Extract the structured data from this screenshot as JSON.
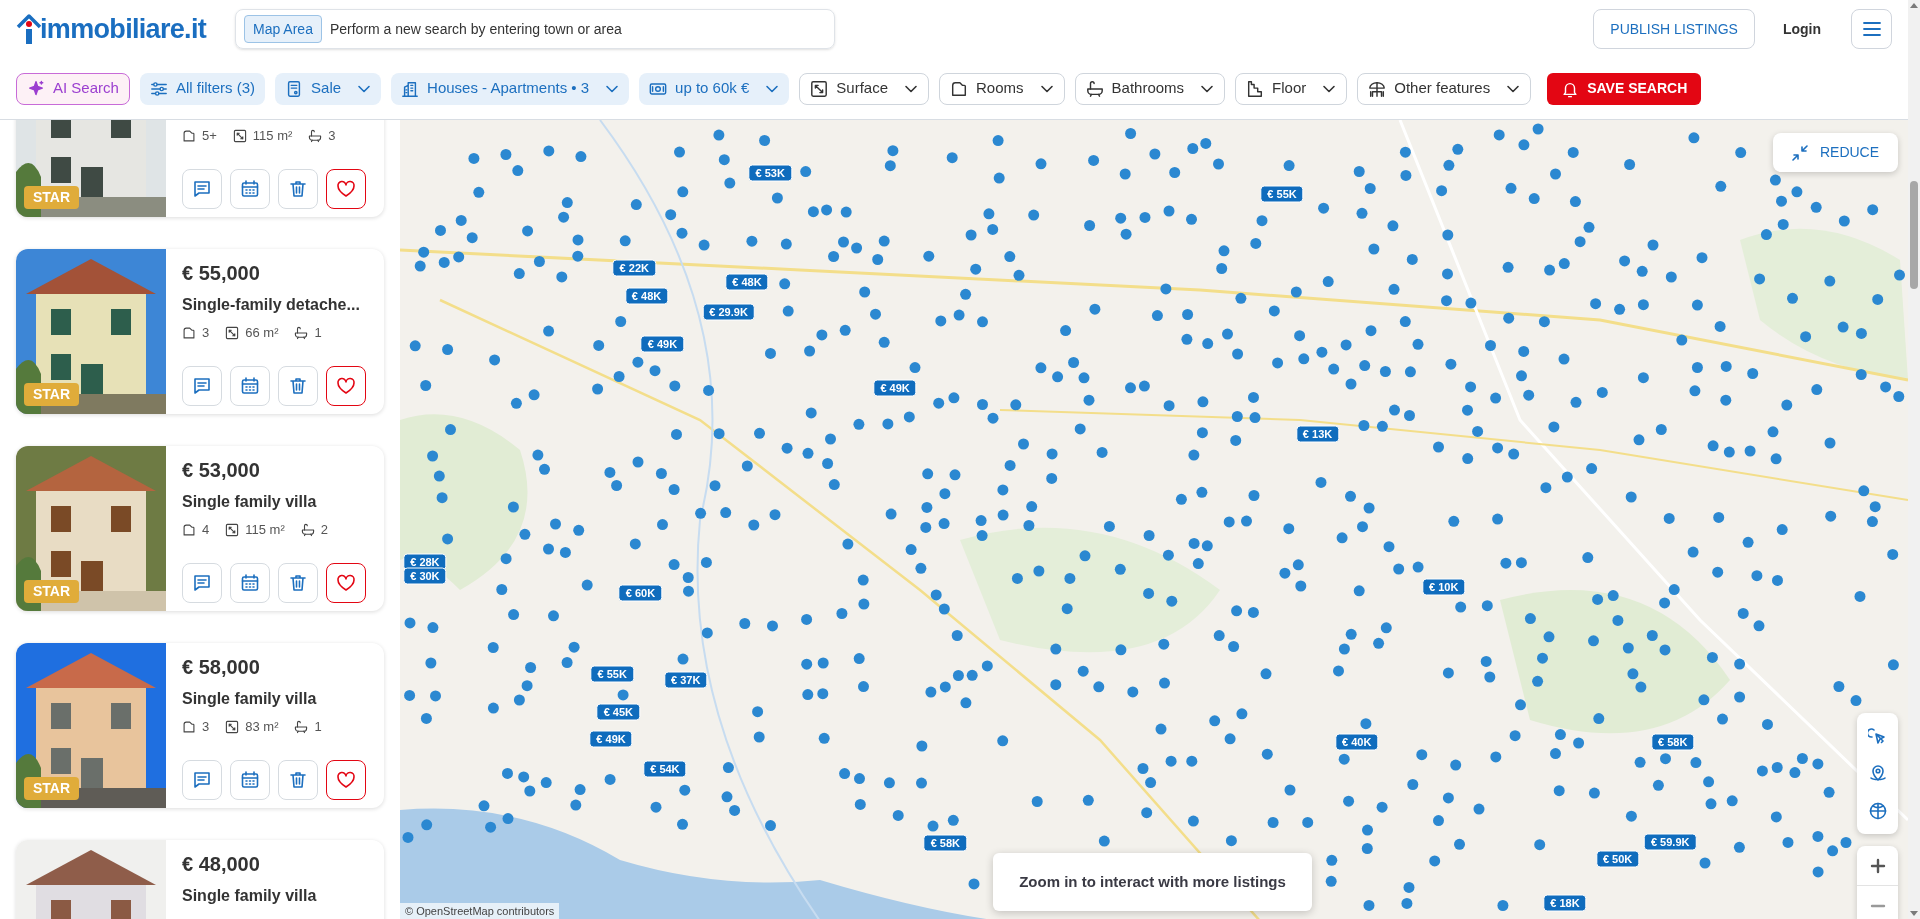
{
  "header": {
    "logo": "immobiliare.it",
    "search": {
      "chip": "Map Area",
      "placeholder": "Perform a new search by entering town or area"
    },
    "publish": "PUBLISH LISTINGS",
    "login": "Login"
  },
  "filters": [
    {
      "kind": "ai",
      "label": "AI Search"
    },
    {
      "kind": "filter",
      "label": "All filters (3)",
      "active": true,
      "dropdown": false
    },
    {
      "kind": "filter",
      "label": "Sale",
      "active": true,
      "dropdown": true
    },
    {
      "kind": "filter",
      "label": "Houses - Apartments • 3",
      "active": true,
      "dropdown": true
    },
    {
      "kind": "filter",
      "label": "up to 60k €",
      "active": true,
      "dropdown": true
    },
    {
      "kind": "filter",
      "label": "Surface",
      "active": false,
      "dropdown": true
    },
    {
      "kind": "filter",
      "label": "Rooms",
      "active": false,
      "dropdown": true
    },
    {
      "kind": "filter",
      "label": "Bathrooms",
      "active": false,
      "dropdown": true
    },
    {
      "kind": "filter",
      "label": "Floor",
      "active": false,
      "dropdown": true
    },
    {
      "kind": "filter",
      "label": "Other features",
      "active": false,
      "dropdown": true
    },
    {
      "kind": "save",
      "label": "SAVE SEARCH"
    }
  ],
  "listings": [
    {
      "rooms": "5+",
      "area": "115 m²",
      "baths": "3",
      "badge": "STAR"
    },
    {
      "price": "€ 55,000",
      "title": "Single-family detache...",
      "rooms": "3",
      "area": "66 m²",
      "baths": "1",
      "badge": "STAR"
    },
    {
      "price": "€ 53,000",
      "title": "Single family villa",
      "rooms": "4",
      "area": "115 m²",
      "baths": "2",
      "badge": "STAR"
    },
    {
      "price": "€ 58,000",
      "title": "Single family villa",
      "rooms": "3",
      "area": "83 m²",
      "baths": "1",
      "badge": "STAR"
    },
    {
      "price": "€ 48,000",
      "title": "Single family villa"
    }
  ],
  "map": {
    "reduce": "REDUCE",
    "notice": "Zoom in to interact with more listings",
    "attribution": "© OpenStreetMap contributors",
    "price_markers": [
      "€ 53K",
      "€ 55K",
      "€ 22K",
      "€ 48K",
      "€ 48K",
      "€ 29.9K",
      "€ 49K",
      "€ 49K",
      "€ 13K",
      "€ 28K",
      "€ 30K",
      "€ 60K",
      "€ 10K",
      "€ 55K",
      "€ 37K",
      "€ 45K",
      "€ 49K",
      "€ 54K",
      "€ 40K",
      "€ 58K",
      "€ 58K",
      "€ 59.9K",
      "€ 50K",
      "€ 18K"
    ]
  }
}
